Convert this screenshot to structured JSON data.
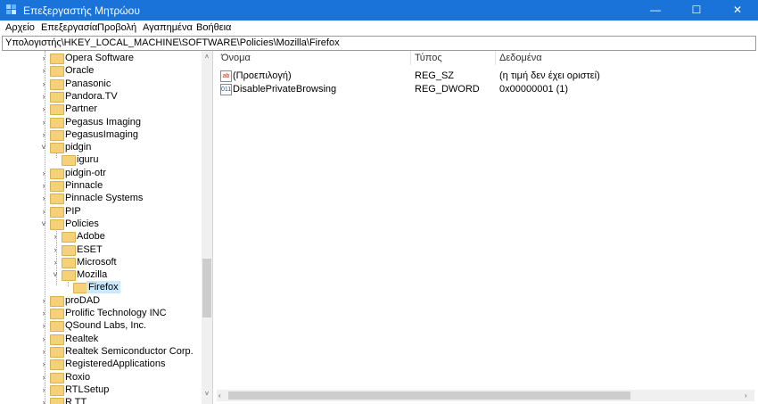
{
  "window": {
    "title": "Επεξεργαστής Μητρώου",
    "minimize": "—",
    "maximize": "☐",
    "close": "✕"
  },
  "menu": [
    "Αρχείο",
    "Επεξεργασία",
    "Προβολή",
    "Αγαπημένα",
    "Βοήθεια"
  ],
  "address": "Υπολογιστής\\HKEY_LOCAL_MACHINE\\SOFTWARE\\Policies\\Mozilla\\Firefox",
  "tree": [
    {
      "label": "Opera Software",
      "expander": "›"
    },
    {
      "label": "Oracle",
      "expander": "›"
    },
    {
      "label": "Panasonic",
      "expander": "›"
    },
    {
      "label": "Pandora.TV",
      "expander": "›"
    },
    {
      "label": "Partner",
      "expander": "›"
    },
    {
      "label": "Pegasus Imaging",
      "expander": "›"
    },
    {
      "label": "PegasusImaging",
      "expander": "›"
    },
    {
      "label": "pidgin",
      "expander": "˅"
    },
    {
      "label": "iguru",
      "expander": ""
    },
    {
      "label": "pidgin-otr",
      "expander": "›"
    },
    {
      "label": "Pinnacle",
      "expander": "›"
    },
    {
      "label": "Pinnacle Systems",
      "expander": "›"
    },
    {
      "label": "PIP",
      "expander": "›"
    },
    {
      "label": "Policies",
      "expander": "˅"
    },
    {
      "label": "Adobe",
      "expander": "›"
    },
    {
      "label": "ESET",
      "expander": "›"
    },
    {
      "label": "Microsoft",
      "expander": "›"
    },
    {
      "label": "Mozilla",
      "expander": "˅"
    },
    {
      "label": "Firefox",
      "expander": ""
    },
    {
      "label": "proDAD",
      "expander": "›"
    },
    {
      "label": "Prolific Technology INC",
      "expander": "›"
    },
    {
      "label": "QSound Labs, Inc.",
      "expander": "›"
    },
    {
      "label": "Realtek",
      "expander": "›"
    },
    {
      "label": "Realtek Semiconductor Corp.",
      "expander": "›"
    },
    {
      "label": "RegisteredApplications",
      "expander": "›"
    },
    {
      "label": "Roxio",
      "expander": "›"
    },
    {
      "label": "RTLSetup",
      "expander": "›"
    },
    {
      "label": "R TT",
      "expander": "›"
    }
  ],
  "list": {
    "headers": [
      "Όνομα",
      "Τύπος",
      "Δεδομένα"
    ],
    "rows": [
      {
        "icon": "ab",
        "name": "(Προεπιλογή)",
        "type": "REG_SZ",
        "data": "(η τιμή δεν έχει οριστεί)"
      },
      {
        "icon": "011",
        "name": "DisablePrivateBrowsing",
        "type": "REG_DWORD",
        "data": "0x00000001 (1)"
      }
    ]
  },
  "scroll": {
    "up": "˄",
    "down": "˅",
    "left": "‹",
    "right": "›"
  },
  "colors": {
    "titlebar": "#1a73d9",
    "folder": "#f5d27a",
    "selection": "#cce8ff"
  }
}
